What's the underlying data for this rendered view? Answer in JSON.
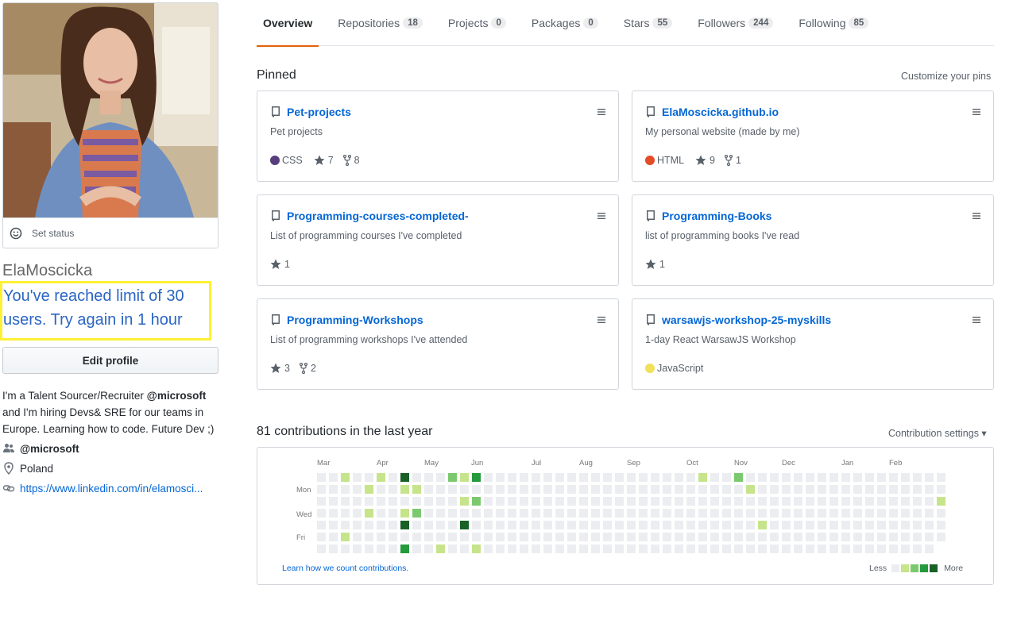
{
  "profile": {
    "set_status": "Set status",
    "username": "ElaMoscicka",
    "limit_message": "You've reached limit of 30 users. Try again in 1 hour",
    "edit_profile": "Edit profile",
    "bio_prefix": "I'm a Talent Sourcer/Recruiter ",
    "bio_mention": "@microsoft",
    "bio_suffix": " and I'm hiring Devs& SRE for our teams in Europe. Learning how to code. Future Dev ;)",
    "organization": "@microsoft",
    "location": "Poland",
    "link": "https://www.linkedin.com/in/elamosci..."
  },
  "tabs": [
    {
      "label": "Overview",
      "count": ""
    },
    {
      "label": "Repositories",
      "count": "18"
    },
    {
      "label": "Projects",
      "count": "0"
    },
    {
      "label": "Packages",
      "count": "0"
    },
    {
      "label": "Stars",
      "count": "55"
    },
    {
      "label": "Followers",
      "count": "244"
    },
    {
      "label": "Following",
      "count": "85"
    }
  ],
  "pinned": {
    "title": "Pinned",
    "customize": "Customize your pins",
    "repos": [
      {
        "name": "Pet-projects",
        "desc": "Pet projects",
        "lang": "CSS",
        "lang_color": "#563d7c",
        "stars": "7",
        "forks": "8"
      },
      {
        "name": "ElaMoscicka.github.io",
        "desc": "My personal website (made by me)",
        "lang": "HTML",
        "lang_color": "#e34c26",
        "stars": "9",
        "forks": "1"
      },
      {
        "name": "Programming-courses-completed-",
        "desc": "List of programming courses I've completed",
        "lang": "",
        "lang_color": "",
        "stars": "1",
        "forks": ""
      },
      {
        "name": "Programming-Books",
        "desc": "list of programming books I've read",
        "lang": "",
        "lang_color": "",
        "stars": "1",
        "forks": ""
      },
      {
        "name": "Programming-Workshops",
        "desc": "List of programming workshops I've attended",
        "lang": "",
        "lang_color": "",
        "stars": "3",
        "forks": "2"
      },
      {
        "name": "warsawjs-workshop-25-myskills",
        "desc": "1-day React WarsawJS Workshop",
        "lang": "JavaScript",
        "lang_color": "#f1e05a",
        "stars": "",
        "forks": ""
      }
    ]
  },
  "contributions": {
    "title": "81 contributions in the last year",
    "settings": "Contribution settings ▾",
    "months": [
      "Mar",
      "Apr",
      "May",
      "Jun",
      "Jul",
      "Aug",
      "Sep",
      "Oct",
      "Nov",
      "Dec",
      "Jan",
      "Feb"
    ],
    "days": [
      "Mon",
      "Wed",
      "Fri"
    ],
    "learn": "Learn how we count contributions.",
    "less": "Less",
    "more": "More",
    "colors": [
      "#ebedf0",
      "#c6e48b",
      "#7bc96f",
      "#239a3b",
      "#196127"
    ],
    "weeks": 53,
    "active_cells": [
      [
        2,
        0,
        1
      ],
      [
        5,
        0,
        1
      ],
      [
        7,
        0,
        4
      ],
      [
        11,
        0,
        2
      ],
      [
        12,
        0,
        1
      ],
      [
        13,
        0,
        3
      ],
      [
        4,
        1,
        1
      ],
      [
        7,
        1,
        1
      ],
      [
        8,
        1,
        1
      ],
      [
        12,
        2,
        1
      ],
      [
        13,
        2,
        2
      ],
      [
        4,
        3,
        1
      ],
      [
        7,
        3,
        1
      ],
      [
        8,
        3,
        2
      ],
      [
        7,
        4,
        4
      ],
      [
        12,
        4,
        4
      ],
      [
        2,
        5,
        1
      ],
      [
        7,
        6,
        3
      ],
      [
        10,
        6,
        1
      ],
      [
        13,
        6,
        1
      ],
      [
        32,
        0,
        1
      ],
      [
        35,
        0,
        2
      ],
      [
        36,
        1,
        1
      ],
      [
        37,
        4,
        1
      ],
      [
        52,
        2,
        1
      ]
    ]
  }
}
